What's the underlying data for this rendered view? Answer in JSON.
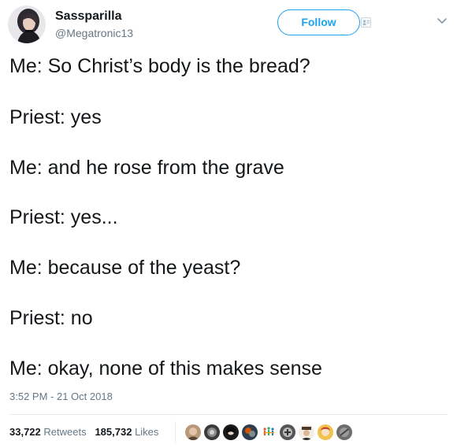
{
  "author": {
    "display_name": "Sassparilla",
    "handle": "@Megatronic13"
  },
  "follow_button": {
    "label": "Follow"
  },
  "tweet": {
    "lines": [
      "Me: So Christ’s body is the bread?",
      "Priest: yes",
      "Me: and he rose from the grave",
      "Priest: yes...",
      "Me: because of the yeast?",
      "Priest: no",
      "Me: okay, none of this makes sense"
    ],
    "timestamp": "3:52 PM - 21 Oct 2018"
  },
  "stats": {
    "retweets_count": "33,722",
    "retweets_label": "Retweets",
    "likes_count": "185,732",
    "likes_label": "Likes"
  },
  "colors": {
    "accent": "#1da1f2",
    "secondary_text": "#657786",
    "primary_text": "#14171a",
    "divider": "#e6ecf0"
  },
  "icons": {
    "caret": "chevron-down-icon",
    "follow_badge": "profile-card-icon"
  }
}
